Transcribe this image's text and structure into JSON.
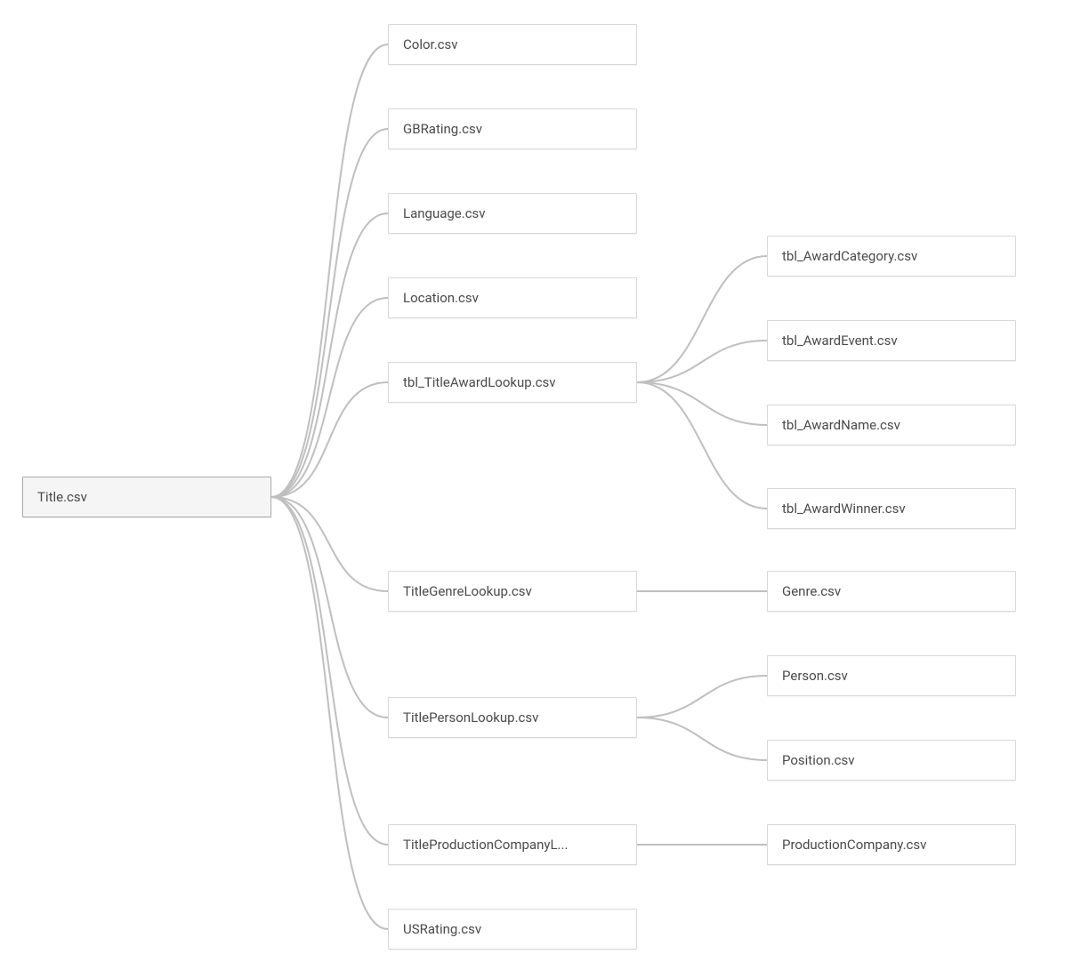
{
  "diagram": {
    "type": "relationship-tree",
    "root": {
      "label": "Title.csv"
    },
    "level1": [
      {
        "label": "Color.csv"
      },
      {
        "label": "GBRating.csv"
      },
      {
        "label": "Language.csv"
      },
      {
        "label": "Location.csv"
      },
      {
        "label": "tbl_TitleAwardLookup.csv"
      },
      {
        "label": "TitleGenreLookup.csv"
      },
      {
        "label": "TitlePersonLookup.csv"
      },
      {
        "label": "TitleProductionCompanyL..."
      },
      {
        "label": "USRating.csv"
      }
    ],
    "award_children": [
      {
        "label": "tbl_AwardCategory.csv"
      },
      {
        "label": "tbl_AwardEvent.csv"
      },
      {
        "label": "tbl_AwardName.csv"
      },
      {
        "label": "tbl_AwardWinner.csv"
      }
    ],
    "genre_children": [
      {
        "label": "Genre.csv"
      }
    ],
    "person_children": [
      {
        "label": "Person.csv"
      },
      {
        "label": "Position.csv"
      }
    ],
    "prodco_children": [
      {
        "label": "ProductionCompany.csv"
      }
    ]
  }
}
